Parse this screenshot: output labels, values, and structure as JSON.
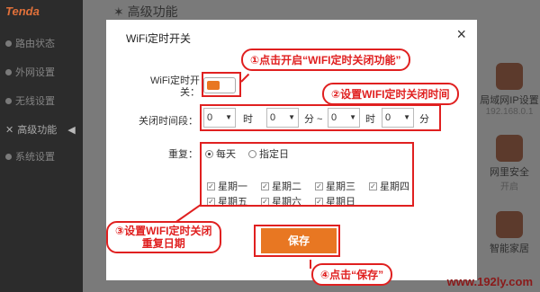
{
  "app": {
    "brand": "Tenda",
    "page_heading": "高级功能"
  },
  "sidebar": {
    "items": [
      {
        "label": "路由状态"
      },
      {
        "label": "外网设置"
      },
      {
        "label": "无线设置"
      },
      {
        "label": "高级功能"
      },
      {
        "label": "系统设置"
      }
    ]
  },
  "right_cards": [
    {
      "label": "局域网IP设置",
      "sub": "192.168.0.1"
    },
    {
      "label": "网里安全",
      "sub": "开启"
    },
    {
      "label": "智能家居",
      "sub": ""
    }
  ],
  "modal": {
    "title": "WiFi定时开关",
    "close": "×",
    "toggle_label": "WiFi定时开关：",
    "toggle_on": true,
    "period_label": "关闭时间段：",
    "selects": [
      "0",
      "0",
      "0",
      "0"
    ],
    "hour": "时",
    "minute_to": "分 ~",
    "hour2": "时",
    "minute": "分",
    "repeat_label": "重复：",
    "repeat_options": [
      "每天",
      "指定日"
    ],
    "repeat_selected": "每天",
    "days": [
      "星期一",
      "星期二",
      "星期三",
      "星期四",
      "星期五",
      "星期六",
      "星期日"
    ],
    "save": "保存"
  },
  "annotations": {
    "a1": "①点击开启“WIFI定时关闭功能”",
    "a2": "②设置WIFI定时关闭时间",
    "a3_line1": "③设置WIFI定时关闭",
    "a3_line2": "重复日期",
    "a4": "④点击“保存”"
  },
  "watermark": "www.192ly.com",
  "colors": {
    "accent": "#e87722",
    "annotation": "#e02020",
    "sidebar": "#2c2c2c"
  }
}
